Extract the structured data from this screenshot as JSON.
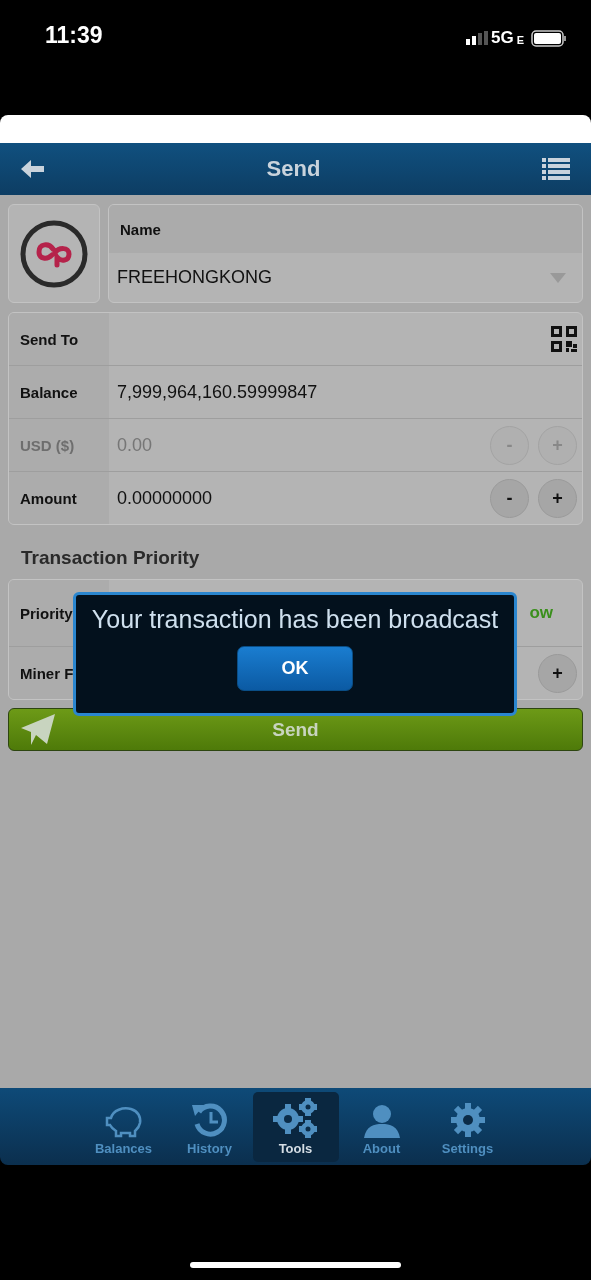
{
  "status_bar": {
    "time": "11:39",
    "network": "5G",
    "network_suffix": "E"
  },
  "header": {
    "title": "Send"
  },
  "account": {
    "label": "Name",
    "value": "FREEHONGKONG"
  },
  "fields": [
    {
      "kind": "scan",
      "label": "Send To",
      "disabled": false
    },
    {
      "kind": "text",
      "label": "Balance",
      "value": "7,999,964,160.59999847",
      "disabled": false
    },
    {
      "kind": "stepper",
      "label": "USD ($)",
      "value": "0.00",
      "disabled": true,
      "buttons": [
        "-",
        "+"
      ]
    },
    {
      "kind": "stepper",
      "label": "Amount",
      "value": "0.00000000",
      "disabled": false,
      "buttons": [
        "-",
        "+"
      ]
    }
  ],
  "priority": {
    "heading": "Transaction Priority",
    "rows": [
      {
        "kind": "text",
        "label": "Priority",
        "value": "ow"
      },
      {
        "kind": "stepper",
        "label": "Miner F",
        "buttons": [
          "+"
        ]
      }
    ]
  },
  "send_button": {
    "label": "Send"
  },
  "dialog": {
    "message": "Your transaction has been broadcast",
    "button": "OK"
  },
  "tabs": [
    {
      "kind": "piggy",
      "label": "Balances",
      "selected": false
    },
    {
      "kind": "history",
      "label": "History",
      "selected": false
    },
    {
      "kind": "tools",
      "label": "Tools",
      "selected": true
    },
    {
      "kind": "person",
      "label": "About",
      "selected": false
    },
    {
      "kind": "gear",
      "label": "Settings",
      "selected": false
    }
  ]
}
